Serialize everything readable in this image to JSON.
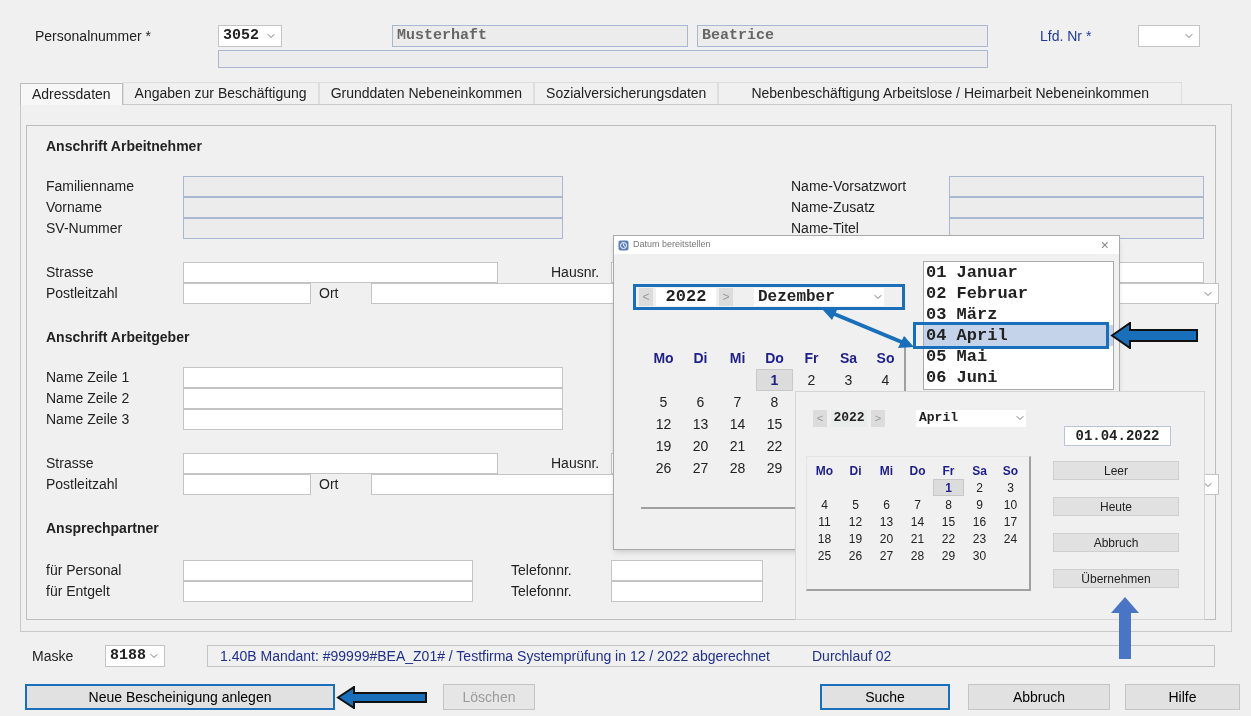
{
  "header": {
    "personalnummer_label": "Personalnummer *",
    "personalnummer": "3052",
    "familienname": "Musterhaft",
    "vorname": "Beatrice",
    "lfd_nr_label": "Lfd. Nr *"
  },
  "tabs": [
    {
      "label": "Adressdaten",
      "selected": true
    },
    {
      "label": "Angaben zur Beschäftigung",
      "selected": false
    },
    {
      "label": "Grunddaten Nebeneinkommen",
      "selected": false
    },
    {
      "label": "Sozialversicherungsdaten",
      "selected": false
    },
    {
      "label": "Nebenbeschäftigung Arbeitslose / Heimarbeit Nebeneinkommen",
      "selected": false
    }
  ],
  "sections": [
    {
      "title": "Anschrift Arbeitnehmer",
      "groups": [
        {
          "kind": "names",
          "rows": [
            {
              "label": "Familienname",
              "readonly": true,
              "right_label": "Name-Vorsatzwort"
            },
            {
              "label": "Vorname",
              "readonly": true,
              "right_label": "Name-Zusatz"
            },
            {
              "label": "SV-Nummer",
              "readonly": true,
              "right_label": "Name-Titel"
            }
          ]
        },
        {
          "kind": "address",
          "street_label": "Strasse",
          "house_label": "Hausnr.",
          "zip_label": "Postleitzahl",
          "city_label": "Ort"
        }
      ]
    },
    {
      "title": "Anschrift Arbeitgeber",
      "groups": [
        {
          "kind": "names",
          "rows": [
            {
              "label": "Name Zeile 1",
              "readonly": false
            },
            {
              "label": "Name Zeile 2",
              "readonly": false
            },
            {
              "label": "Name Zeile 3",
              "readonly": false
            }
          ]
        },
        {
          "kind": "address",
          "street_label": "Strasse",
          "house_label": "Hausnr.",
          "zip_label": "Postleitzahl",
          "city_label": "Ort"
        }
      ]
    },
    {
      "title": "Ansprechpartner",
      "groups": [
        {
          "kind": "contacts",
          "rows": [
            {
              "label": "für Personal",
              "phone_label": "Telefonnr."
            },
            {
              "label": "für Entgelt",
              "phone_label": "Telefonnr."
            }
          ]
        }
      ]
    }
  ],
  "footer": {
    "mask_label": "Maske",
    "mask": "8188",
    "status": "1.40B Mandant: #99999#BEA_Z01# / Testfirma Systemprüfung in 12 / 2022 abgerechnet",
    "run": "Durchlauf 02"
  },
  "buttons": [
    {
      "label": "Neue Bescheinigung anlegen",
      "disabled": false,
      "default": true
    },
    {
      "label": "Löschen",
      "disabled": true,
      "default": false
    },
    {
      "label": "Suche",
      "disabled": false,
      "default": true
    },
    {
      "label": "Abbruch",
      "disabled": false,
      "default": false
    },
    {
      "label": "Hilfe",
      "disabled": false,
      "default": false
    }
  ],
  "date_dialog": {
    "title": "Datum bereitstellen",
    "close": "×",
    "prev": "<",
    "year": "2022",
    "next": ">",
    "month": "Dezember",
    "weekdays": [
      "Mo",
      "Di",
      "Mi",
      "Do",
      "Fr",
      "Sa",
      "So"
    ],
    "weeks": [
      [
        {
          "kind": "blank"
        },
        {
          "kind": "blank"
        },
        {
          "kind": "blank"
        },
        {
          "kind": "day",
          "text": "1",
          "selected": true
        },
        {
          "kind": "day",
          "text": "2",
          "selected": false
        },
        {
          "kind": "day",
          "text": "3",
          "selected": false
        },
        {
          "kind": "day",
          "text": "4",
          "selected": false
        }
      ],
      [
        {
          "kind": "day",
          "text": "5",
          "selected": false
        },
        {
          "kind": "day",
          "text": "6",
          "selected": false
        },
        {
          "kind": "day",
          "text": "7",
          "selected": false
        },
        {
          "kind": "day",
          "text": "8",
          "selected": false
        }
      ],
      [
        {
          "kind": "day",
          "text": "12",
          "selected": false
        },
        {
          "kind": "day",
          "text": "13",
          "selected": false
        },
        {
          "kind": "day",
          "text": "14",
          "selected": false
        },
        {
          "kind": "day",
          "text": "15",
          "selected": false
        }
      ],
      [
        {
          "kind": "day",
          "text": "19",
          "selected": false
        },
        {
          "kind": "day",
          "text": "20",
          "selected": false
        },
        {
          "kind": "day",
          "text": "21",
          "selected": false
        },
        {
          "kind": "day",
          "text": "22",
          "selected": false
        }
      ],
      [
        {
          "kind": "day",
          "text": "26",
          "selected": false
        },
        {
          "kind": "day",
          "text": "27",
          "selected": false
        },
        {
          "kind": "day",
          "text": "28",
          "selected": false
        },
        {
          "kind": "day",
          "text": "29",
          "selected": false
        }
      ]
    ],
    "months": [
      {
        "label": "01 Januar",
        "selected": false
      },
      {
        "label": "02 Februar",
        "selected": false
      },
      {
        "label": "03 März",
        "selected": false
      },
      {
        "label": "04 April",
        "selected": true
      },
      {
        "label": "05 Mai",
        "selected": false
      },
      {
        "label": "06 Juni",
        "selected": false
      }
    ]
  },
  "date_picker": {
    "prev": "<",
    "year": "2022",
    "next": ">",
    "month": "April",
    "date": "01.04.2022",
    "weekdays": [
      "Mo",
      "Di",
      "Mi",
      "Do",
      "Fr",
      "Sa",
      "So"
    ],
    "weeks": [
      [
        {
          "kind": "blank"
        },
        {
          "kind": "blank"
        },
        {
          "kind": "blank"
        },
        {
          "kind": "blank"
        },
        {
          "kind": "day",
          "text": "1",
          "selected": true
        },
        {
          "kind": "day",
          "text": "2",
          "selected": false
        },
        {
          "kind": "day",
          "text": "3",
          "selected": false
        }
      ],
      [
        {
          "kind": "day",
          "text": "4",
          "selected": false
        },
        {
          "kind": "day",
          "text": "5",
          "selected": false
        },
        {
          "kind": "day",
          "text": "6",
          "selected": false
        },
        {
          "kind": "day",
          "text": "7",
          "selected": false
        },
        {
          "kind": "day",
          "text": "8",
          "selected": false
        },
        {
          "kind": "day",
          "text": "9",
          "selected": false
        },
        {
          "kind": "day",
          "text": "10",
          "selected": false
        }
      ],
      [
        {
          "kind": "day",
          "text": "11",
          "selected": false
        },
        {
          "kind": "day",
          "text": "12",
          "selected": false
        },
        {
          "kind": "day",
          "text": "13",
          "selected": false
        },
        {
          "kind": "day",
          "text": "14",
          "selected": false
        },
        {
          "kind": "day",
          "text": "15",
          "selected": false
        },
        {
          "kind": "day",
          "text": "16",
          "selected": false
        },
        {
          "kind": "day",
          "text": "17",
          "selected": false
        }
      ],
      [
        {
          "kind": "day",
          "text": "18",
          "selected": false
        },
        {
          "kind": "day",
          "text": "19",
          "selected": false
        },
        {
          "kind": "day",
          "text": "20",
          "selected": false
        },
        {
          "kind": "day",
          "text": "21",
          "selected": false
        },
        {
          "kind": "day",
          "text": "22",
          "selected": false
        },
        {
          "kind": "day",
          "text": "23",
          "selected": false
        },
        {
          "kind": "day",
          "text": "24",
          "selected": false
        }
      ],
      [
        {
          "kind": "day",
          "text": "25",
          "selected": false
        },
        {
          "kind": "day",
          "text": "26",
          "selected": false
        },
        {
          "kind": "day",
          "text": "27",
          "selected": false
        },
        {
          "kind": "day",
          "text": "28",
          "selected": false
        },
        {
          "kind": "day",
          "text": "29",
          "selected": false
        },
        {
          "kind": "day",
          "text": "30",
          "selected": false
        }
      ]
    ],
    "buttons": [
      "Leer",
      "Heute",
      "Abbruch",
      "Übernehmen"
    ]
  }
}
